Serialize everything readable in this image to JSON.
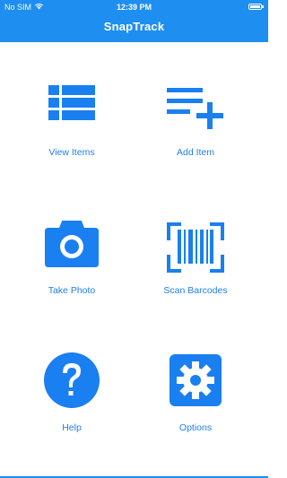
{
  "status_bar": {
    "carrier": "No SIM",
    "time": "12:39 PM",
    "wifi_icon": "wifi-icon",
    "battery_icon": "battery-icon"
  },
  "header": {
    "title": "SnapTrack"
  },
  "menu": {
    "view_items": {
      "label": "View Items",
      "icon": "list-icon"
    },
    "add_item": {
      "label": "Add Item",
      "icon": "add-list-icon"
    },
    "take_photo": {
      "label": "Take Photo",
      "icon": "camera-icon"
    },
    "scan_barcodes": {
      "label": "Scan Barcodes",
      "icon": "barcode-scan-icon"
    },
    "help": {
      "label": "Help",
      "icon": "help-icon"
    },
    "options": {
      "label": "Options",
      "icon": "gear-icon"
    }
  },
  "colors": {
    "accent": "#1f8ef1",
    "icon": "#1a7ff0",
    "label": "#1f7fe8"
  }
}
